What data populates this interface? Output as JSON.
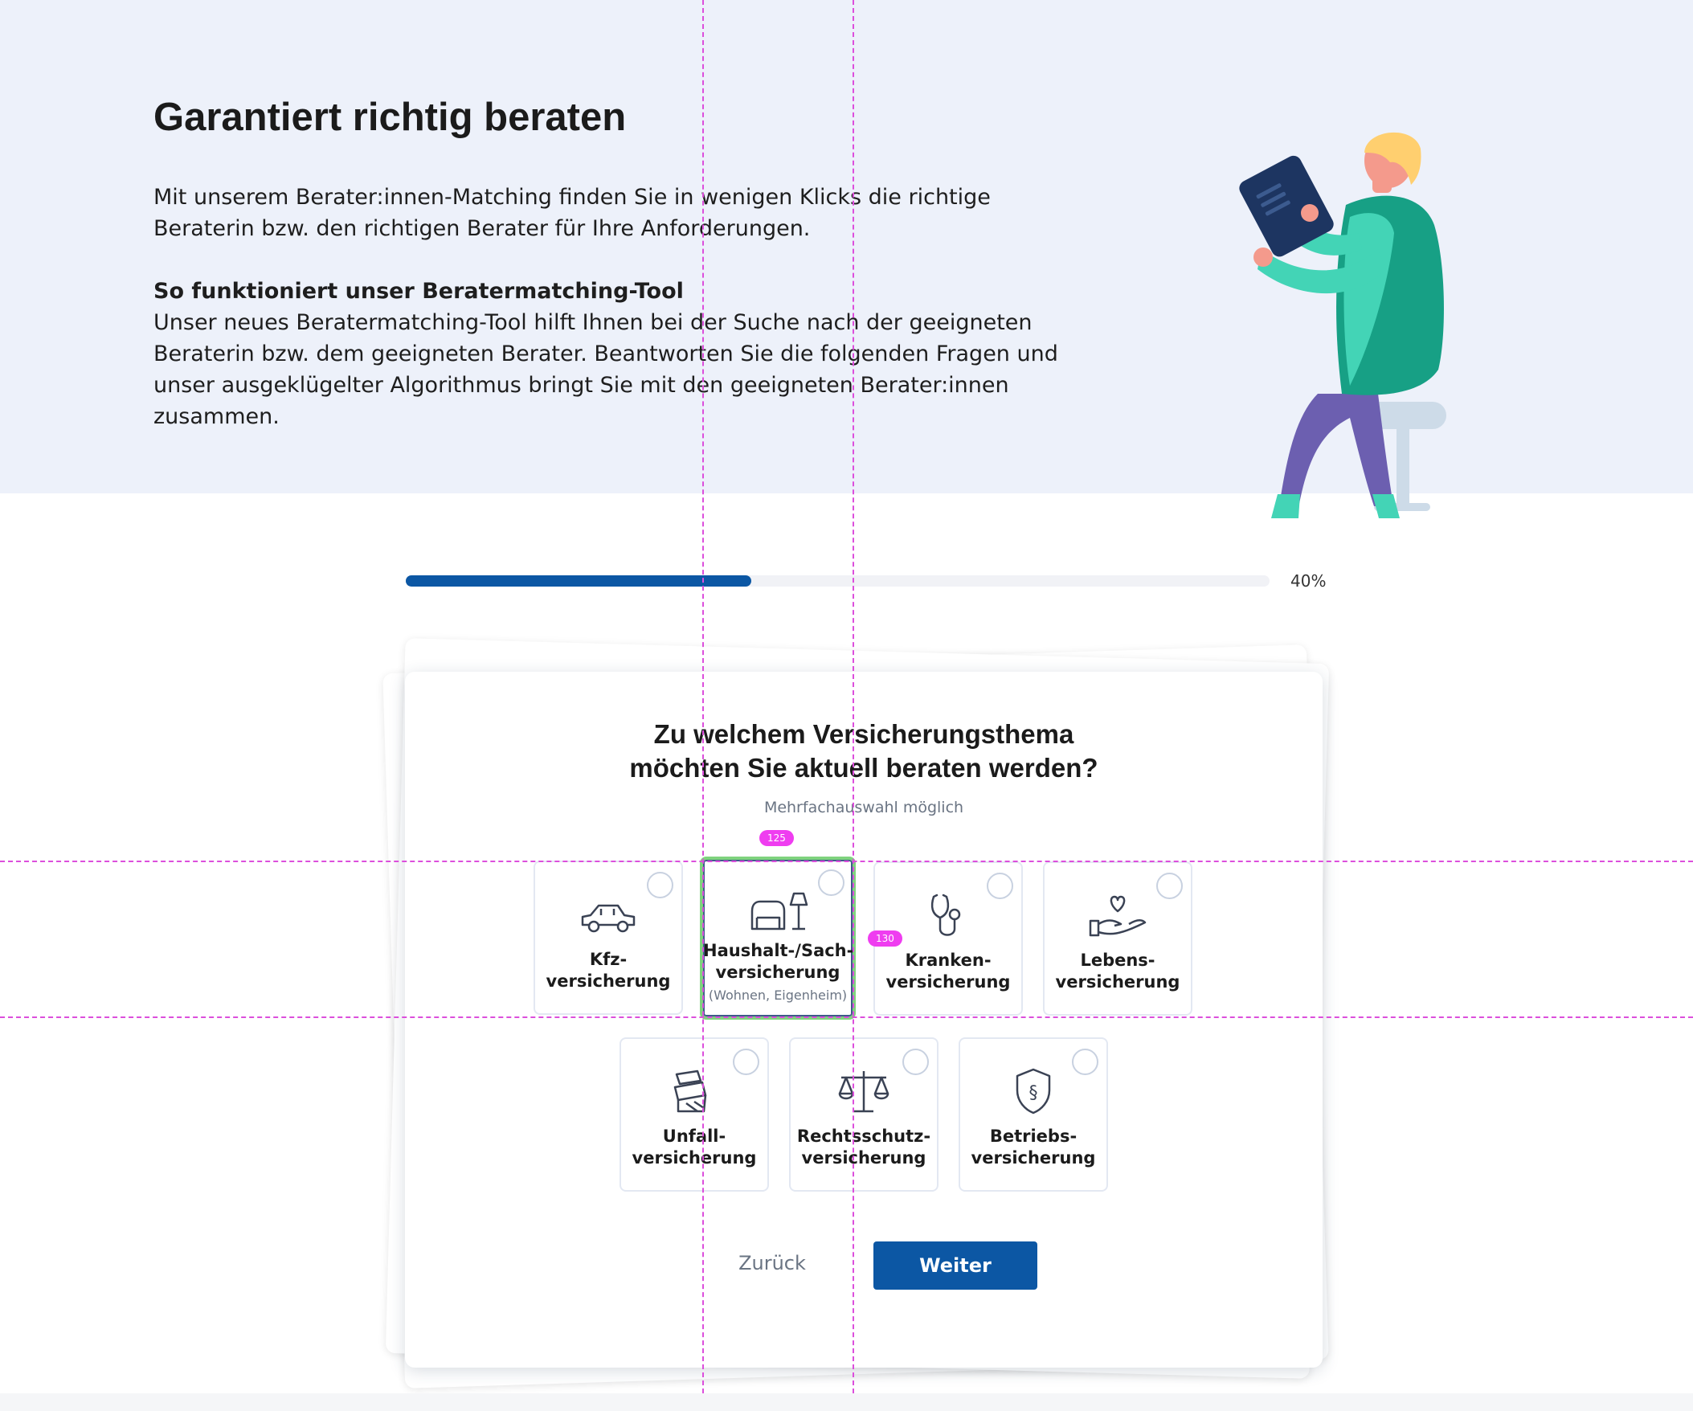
{
  "hero": {
    "title": "Garantiert richtig beraten",
    "intro": "Mit unserem Berater:innen-Matching finden Sie in wenigen Klicks die richtige Beraterin bzw. den richtigen Berater für Ihre Anforderungen.",
    "subheading": "So funktioniert unser Beratermatching-Tool",
    "body": "Unser neues Beratermatching-Tool hilft Ihnen bei der Suche nach der geeigneten Beraterin bzw. dem geeigneten Berater. Beantworten Sie die folgenden Fragen und unser ausgeklügelter Algorithmus bringt Sie mit den geeigneten Berater:innen zusammen."
  },
  "progress": {
    "fraction": 0.4,
    "label": "40%",
    "accent": "#0c57a4"
  },
  "wizard": {
    "question_line1": "Zu welchem Versicherungsthema",
    "question_line2": "möchten Sie aktuell beraten werden?",
    "hint": "Mehrfachauswahl möglich",
    "options": [
      {
        "line1": "Kfz-",
        "line2": "versicherung",
        "sub": "",
        "icon": "car-icon",
        "selected": false
      },
      {
        "line1": "Haushalt-/Sach-",
        "line2": "versicherung",
        "sub": "(Wohnen, Eigenheim)",
        "icon": "armchair-lamp-icon",
        "selected": true
      },
      {
        "line1": "Kranken-",
        "line2": "versicherung",
        "sub": "",
        "icon": "stethoscope-icon",
        "selected": false
      },
      {
        "line1": "Lebens-",
        "line2": "versicherung",
        "sub": "",
        "icon": "hand-heart-icon",
        "selected": false
      },
      {
        "line1": "Unfall-",
        "line2": "versicherung",
        "sub": "",
        "icon": "accident-icon",
        "selected": false
      },
      {
        "line1": "Rechtsschutz-",
        "line2": "versicherung",
        "sub": "",
        "icon": "scales-icon",
        "selected": false
      },
      {
        "line1": "Betriebs-",
        "line2": "versicherung",
        "sub": "",
        "icon": "shield-paragraph-icon",
        "selected": false
      }
    ],
    "back_label": "Zurück",
    "next_label": "Weiter"
  },
  "overlay": {
    "badge_width": "125",
    "badge_height": "130",
    "color": "#dc4fdc"
  }
}
